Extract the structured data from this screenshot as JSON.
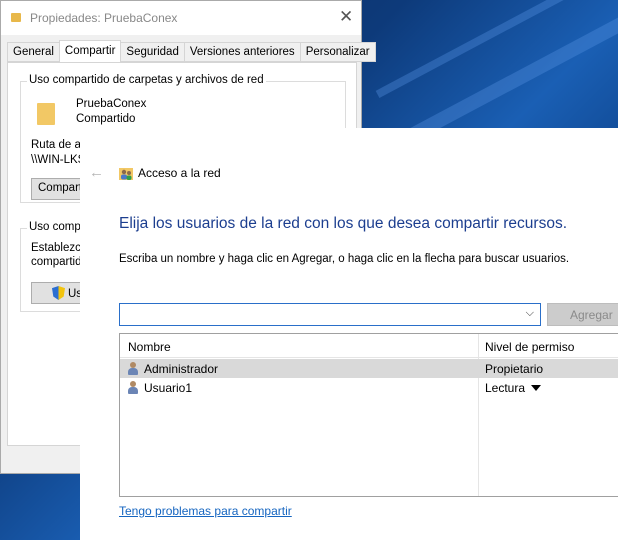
{
  "properties_window": {
    "title": "Propiedades: PruebaConex",
    "close_glyph": "✕",
    "tabs": [
      "General",
      "Compartir",
      "Seguridad",
      "Versiones anteriores",
      "Personalizar"
    ],
    "active_tab": "Compartir",
    "network_group": {
      "label": "Uso compartido de carpetas y archivos de red",
      "folder_name": "PruebaConex",
      "folder_status": "Compartido",
      "path_label": "Ruta de ac",
      "path_value": "\\\\WIN-LKS",
      "share_button": "Comparti"
    },
    "advanced_group": {
      "label": "Uso compa",
      "desc_line1": "Establezca",
      "desc_line2": "compartido",
      "button": "Us"
    }
  },
  "dialog": {
    "back_glyph": "←",
    "title": "Acceso a la red",
    "heading": "Elija los usuarios de la red con los que desea compartir recursos.",
    "instruction": "Escriba un nombre y haga clic en Agregar, o haga clic en la flecha para buscar usuarios.",
    "combo_value": "",
    "combo_arrow_glyph": "⌵",
    "add_button": "Agregar",
    "columns": [
      "Nombre",
      "Nivel de permiso"
    ],
    "rows": [
      {
        "name": "Administrador",
        "permission": "Propietario",
        "selected": true
      },
      {
        "name": "Usuario1",
        "permission": "Lectura",
        "selected": false
      }
    ],
    "help_link": "Tengo problemas para compartir"
  }
}
